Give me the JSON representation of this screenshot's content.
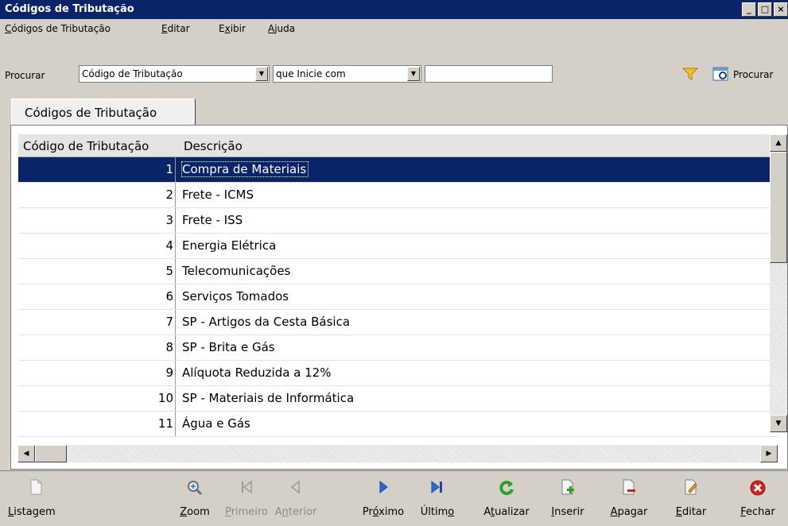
{
  "window": {
    "title": "Códigos de Tributação"
  },
  "menu": [
    {
      "pre": "",
      "key": "C",
      "post": "ódigos de Tributação"
    },
    {
      "pre": "",
      "key": "E",
      "post": "ditar"
    },
    {
      "pre": "E",
      "key": "x",
      "post": "ibir"
    },
    {
      "pre": "",
      "key": "A",
      "post": "juda"
    }
  ],
  "search": {
    "label": "Procurar",
    "field_value": "Código de Tributação",
    "mode_value": "que Inicie com",
    "text_value": "",
    "button_label": "Procurar"
  },
  "tabs": [
    {
      "label": "Códigos de Tributação",
      "active": true
    }
  ],
  "grid": {
    "columns": [
      "Código de Tributação",
      "Descrição"
    ],
    "rows": [
      {
        "code": "1",
        "desc": "Compra de Materiais",
        "selected": true
      },
      {
        "code": "2",
        "desc": "Frete - ICMS"
      },
      {
        "code": "3",
        "desc": "Frete - ISS"
      },
      {
        "code": "4",
        "desc": "Energia Elétrica"
      },
      {
        "code": "5",
        "desc": "Telecomunicações"
      },
      {
        "code": "6",
        "desc": "Serviços Tomados"
      },
      {
        "code": "7",
        "desc": "SP - Artigos da Cesta Básica"
      },
      {
        "code": "8",
        "desc": "SP - Brita e Gás"
      },
      {
        "code": "9",
        "desc": "Alíquota Reduzida a 12%"
      },
      {
        "code": "10",
        "desc": "SP - Materiais de Informática"
      },
      {
        "code": "11",
        "desc": "Água e Gás"
      }
    ]
  },
  "toolbar": [
    {
      "name": "listagem",
      "pre": "",
      "key": "L",
      "post": "istagem",
      "icon": "document-icon",
      "enabled": true
    },
    {
      "name": "zoom",
      "pre": "",
      "key": "Z",
      "post": "oom",
      "icon": "zoom-icon",
      "enabled": true
    },
    {
      "name": "primeiro",
      "pre": "",
      "key": "P",
      "post": "rimeiro",
      "icon": "first-record-icon",
      "enabled": false
    },
    {
      "name": "anterior",
      "pre": "A",
      "key": "n",
      "post": "terior",
      "icon": "previous-record-icon",
      "enabled": false
    },
    {
      "name": "proximo",
      "pre": "Pr",
      "key": "ó",
      "post": "ximo",
      "icon": "next-record-icon",
      "enabled": true
    },
    {
      "name": "ultimo",
      "pre": "Últim",
      "key": "o",
      "post": "",
      "icon": "last-record-icon",
      "enabled": true
    },
    {
      "name": "atualizar",
      "pre": "A",
      "key": "t",
      "post": "ualizar",
      "icon": "refresh-icon",
      "enabled": true
    },
    {
      "name": "inserir",
      "pre": "",
      "key": "I",
      "post": "nserir",
      "icon": "insert-icon",
      "enabled": true
    },
    {
      "name": "apagar",
      "pre": "",
      "key": "A",
      "post": "pagar",
      "icon": "delete-icon",
      "enabled": true
    },
    {
      "name": "editar",
      "pre": "",
      "key": "E",
      "post": "ditar",
      "icon": "edit-icon",
      "enabled": true
    },
    {
      "name": "fechar",
      "pre": "",
      "key": "F",
      "post": "echar",
      "icon": "close-icon",
      "enabled": true
    }
  ],
  "colors": {
    "titlebar": "#0a246a",
    "selection": "#0a246a",
    "face": "#d4d0c8"
  }
}
